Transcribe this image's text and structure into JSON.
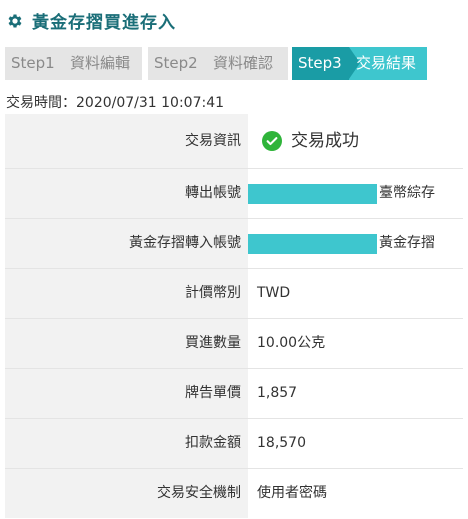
{
  "page": {
    "title": "黃金存摺買進存入",
    "title_icon": "gear-icon",
    "accent_color": "#1a6e78"
  },
  "steps": [
    {
      "num": "Step1",
      "label": "資料編輯",
      "state": "done"
    },
    {
      "num": "Step2",
      "label": "資料確認",
      "state": "done"
    },
    {
      "num": "Step3",
      "label": "交易結果",
      "state": "active"
    }
  ],
  "transaction_time": "交易時間：2020/07/31 10:07:41",
  "details": {
    "status": {
      "label": "交易資訊",
      "value": "交易成功",
      "icon": "check-circle-icon"
    },
    "from_account": {
      "label": "轉出帳號",
      "type": "臺幣綜存"
    },
    "to_account": {
      "label": "黃金存摺轉入帳號",
      "type": "黃金存摺"
    },
    "currency": {
      "label": "計價幣別",
      "value": "TWD"
    },
    "quantity": {
      "label": "買進數量",
      "value": "10.00公克"
    },
    "unit_price": {
      "label": "牌告單價",
      "value": "1,857"
    },
    "debit_amount": {
      "label": "扣款金額",
      "value": "18,570"
    },
    "security": {
      "label": "交易安全機制",
      "value": "使用者密碼"
    }
  }
}
